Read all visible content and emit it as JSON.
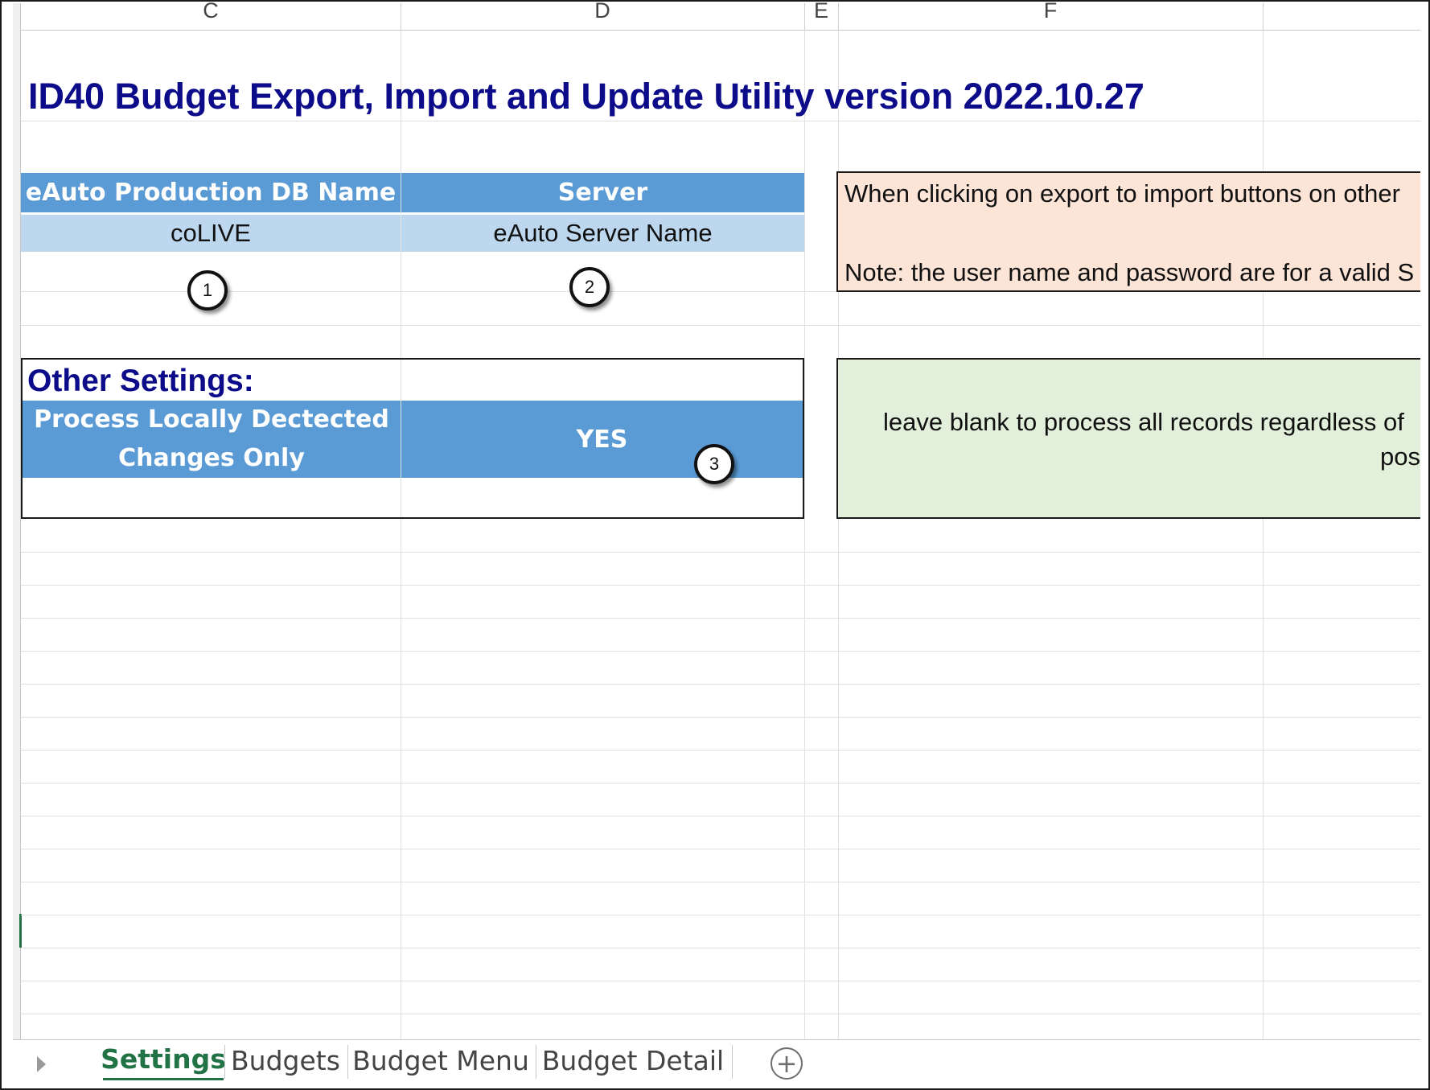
{
  "columns": [
    "C",
    "D",
    "E",
    "F"
  ],
  "title": "ID40 Budget Export, Import and Update Utility version 2022.10.27",
  "db_table": {
    "header_db": "eAuto Production DB Name",
    "header_server": "Server",
    "value_db": "coLIVE",
    "value_server": "eAuto Server Name"
  },
  "other_settings": {
    "label": "Other Settings:",
    "setting_label_line1": "Process Locally Dectected",
    "setting_label_line2": "Changes Only",
    "setting_value": "YES"
  },
  "notes": {
    "orange_line1": "When clicking on export to import buttons on other",
    "orange_line2": "Note: the user name and password are for a valid S",
    "green_line1": "leave blank to process all records regardless of",
    "green_line2": "pos"
  },
  "callouts": [
    "1",
    "2",
    "3"
  ],
  "sheet_tabs": [
    {
      "label": "Settings",
      "active": true
    },
    {
      "label": "Budgets",
      "active": false
    },
    {
      "label": "Budget Menu",
      "active": false
    },
    {
      "label": "Budget Detail",
      "active": false
    }
  ],
  "add_sheet_glyph": "+",
  "colors": {
    "title": "#0c0c8a",
    "header_blue": "#5b9bd5",
    "value_blue": "#bdd7ee",
    "note_orange": "#fce4d6",
    "note_green": "#e2efda",
    "excel_green": "#217346"
  }
}
